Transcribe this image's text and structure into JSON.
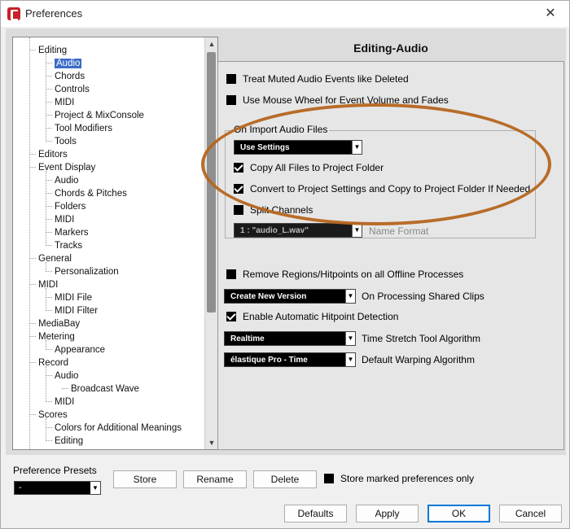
{
  "window": {
    "title": "Preferences",
    "close_glyph": "✕"
  },
  "tree": {
    "items": [
      {
        "label": "Editing",
        "level": 1
      },
      {
        "label": "Audio",
        "level": 2,
        "selected": true
      },
      {
        "label": "Chords",
        "level": 2
      },
      {
        "label": "Controls",
        "level": 2
      },
      {
        "label": "MIDI",
        "level": 2
      },
      {
        "label": "Project & MixConsole",
        "level": 2
      },
      {
        "label": "Tool Modifiers",
        "level": 2
      },
      {
        "label": "Tools",
        "level": 2
      },
      {
        "label": "Editors",
        "level": 1
      },
      {
        "label": "Event Display",
        "level": 1
      },
      {
        "label": "Audio",
        "level": 2
      },
      {
        "label": "Chords & Pitches",
        "level": 2
      },
      {
        "label": "Folders",
        "level": 2
      },
      {
        "label": "MIDI",
        "level": 2
      },
      {
        "label": "Markers",
        "level": 2
      },
      {
        "label": "Tracks",
        "level": 2
      },
      {
        "label": "General",
        "level": 1
      },
      {
        "label": "Personalization",
        "level": 2
      },
      {
        "label": "MIDI",
        "level": 1
      },
      {
        "label": "MIDI File",
        "level": 2
      },
      {
        "label": "MIDI Filter",
        "level": 2
      },
      {
        "label": "MediaBay",
        "level": 1
      },
      {
        "label": "Metering",
        "level": 1
      },
      {
        "label": "Appearance",
        "level": 2
      },
      {
        "label": "Record",
        "level": 1
      },
      {
        "label": "Audio",
        "level": 2
      },
      {
        "label": "Broadcast Wave",
        "level": 3
      },
      {
        "label": "MIDI",
        "level": 2
      },
      {
        "label": "Scores",
        "level": 1
      },
      {
        "label": "Colors for Additional Meanings",
        "level": 2
      },
      {
        "label": "Editing",
        "level": 2
      }
    ]
  },
  "panel": {
    "title": "Editing-Audio",
    "treat_muted": {
      "label": "Treat Muted Audio Events like Deleted",
      "checked": false
    },
    "mouse_wheel": {
      "label": "Use Mouse Wheel for Event Volume and Fades",
      "checked": false
    },
    "import_group": {
      "label": "On Import Audio Files",
      "settings_select": "Use Settings",
      "copy_files": {
        "label": "Copy All Files to Project Folder",
        "checked": true
      },
      "convert": {
        "label": "Convert to Project Settings and Copy to Project Folder If Needed",
        "checked": true
      },
      "split_channels": {
        "label": "Split Channels",
        "checked": false
      },
      "name_format_value": "1 : \"audio_L.wav\"",
      "name_format_label": "Name Format"
    },
    "remove_regions": {
      "label": "Remove Regions/Hitpoints on all Offline Processes",
      "checked": false
    },
    "shared_clips": {
      "value": "Create New Version",
      "label": "On Processing Shared Clips"
    },
    "hitpoint": {
      "label": "Enable Automatic Hitpoint Detection",
      "checked": true
    },
    "time_stretch": {
      "value": "Realtime",
      "label": "Time Stretch Tool Algorithm"
    },
    "warping": {
      "value": "élastique Pro - Time",
      "label": "Default Warping Algorithm"
    }
  },
  "footer": {
    "presets_label": "Preference Presets",
    "presets_value": "-",
    "store": "Store",
    "rename": "Rename",
    "delete": "Delete",
    "store_marked": "Store marked preferences only",
    "defaults": "Defaults",
    "apply": "Apply",
    "ok": "OK",
    "cancel": "Cancel"
  },
  "colors": {
    "selection": "#3b6cc6",
    "annotation": "#b5651d",
    "ok_border": "#0078d7"
  }
}
